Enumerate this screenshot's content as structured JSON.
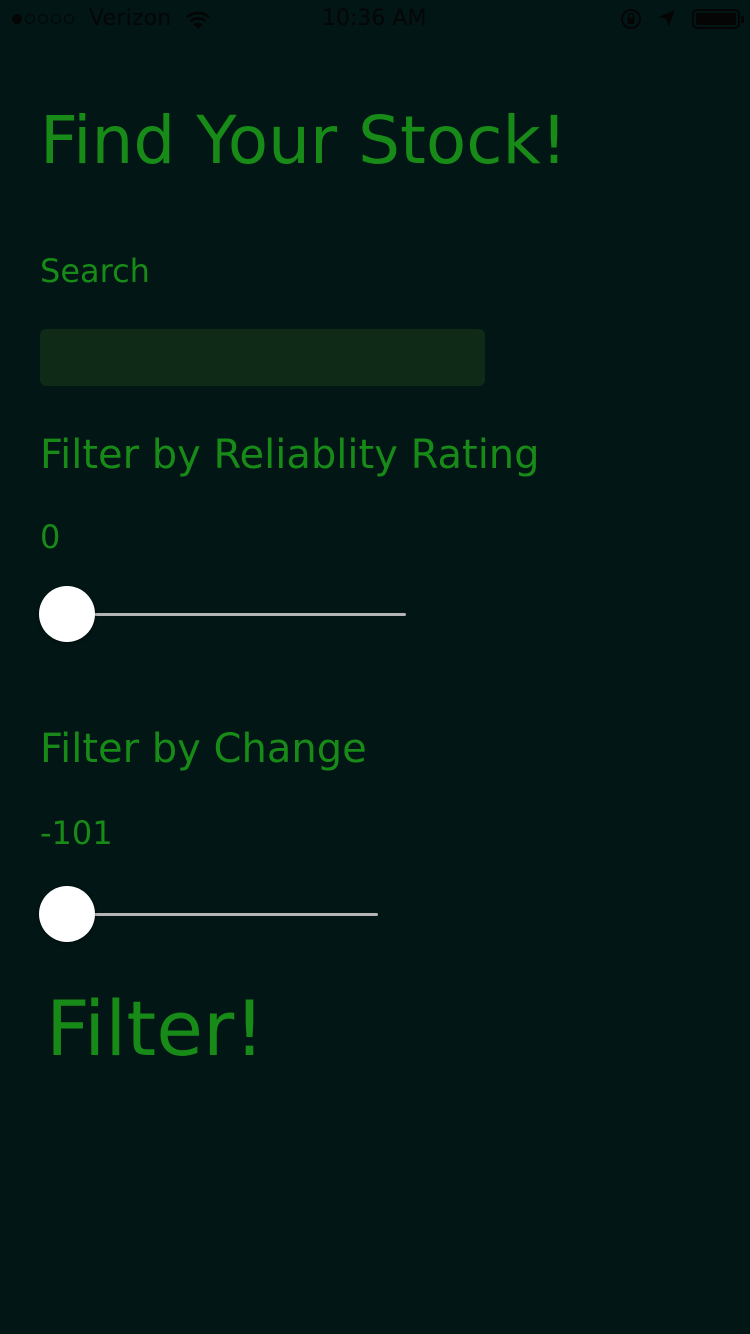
{
  "status_bar": {
    "signal_bars_filled": 1,
    "signal_bars_total": 5,
    "carrier": "Verizon",
    "time": "10:36 AM",
    "icons": [
      "wifi-icon",
      "orientation-lock-icon",
      "location-arrow-icon",
      "battery-icon"
    ],
    "battery_level": 1.0
  },
  "page": {
    "title": "Find Your Stock!",
    "search": {
      "label": "Search",
      "value": "",
      "placeholder": ""
    },
    "reliability_filter": {
      "label": "Filter by Reliablity Rating",
      "value_text": "0",
      "slider_fraction": 0
    },
    "change_filter": {
      "label": "Filter by Change",
      "value_text": "-101",
      "slider_fraction": 0
    },
    "filter_button_label": "Filter!"
  },
  "colors": {
    "background": "#011615",
    "accent_green": "#188a18",
    "input_background": "#0f2a17",
    "slider_track": "#b5b5b5",
    "slider_thumb": "#ffffff"
  }
}
